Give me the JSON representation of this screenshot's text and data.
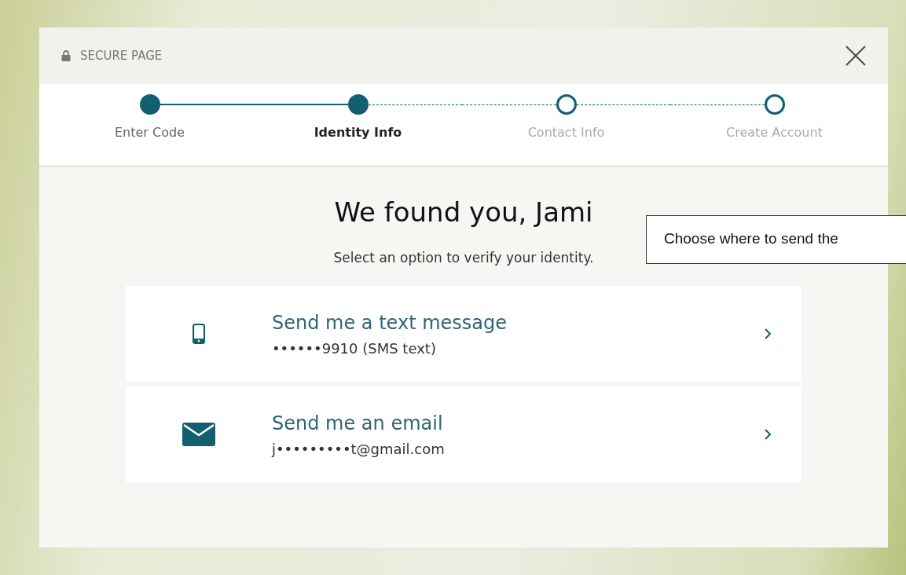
{
  "header": {
    "title": "SECURE PAGE"
  },
  "steps": [
    {
      "label": "Enter Code",
      "completed": true,
      "selected": false
    },
    {
      "label": "Identity Info",
      "completed": false,
      "selected": true
    },
    {
      "label": "Contact Info",
      "completed": false,
      "selected": false
    },
    {
      "label": "Create Account",
      "completed": false,
      "selected": false
    }
  ],
  "heading": "We found you, Jami",
  "subheading": "Select an option to verify your identity.",
  "options": [
    {
      "kind": "phone",
      "title": "Send me a text message",
      "detail": "••••••9910 (SMS text)"
    },
    {
      "kind": "email",
      "title": "Send me an email",
      "detail": "j•••••••••t@gmail.com"
    }
  ],
  "callout": "Choose where to send the"
}
